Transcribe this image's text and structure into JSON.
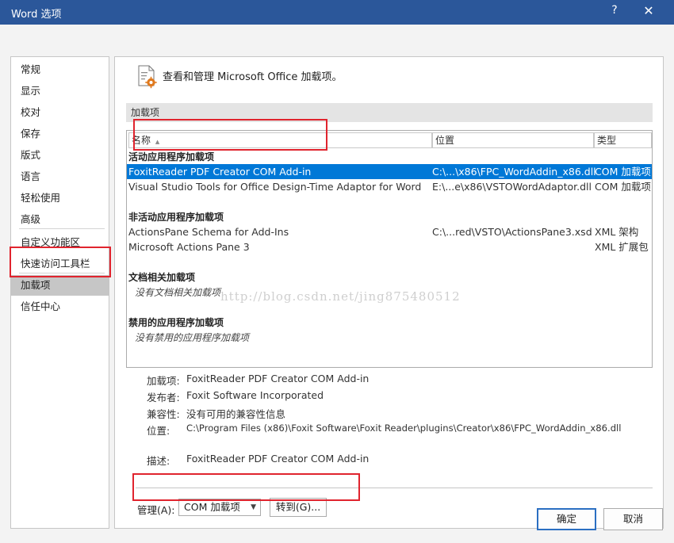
{
  "window": {
    "title": "Word 选项",
    "help": "?",
    "close": "✕"
  },
  "nav": {
    "items": [
      "常规",
      "显示",
      "校对",
      "保存",
      "版式",
      "语言",
      "轻松使用",
      "高级",
      "自定义功能区",
      "快速访问工具栏",
      "加载项",
      "信任中心"
    ],
    "selected": "加载项"
  },
  "header": {
    "icon": "addins-gear-icon",
    "text": "查看和管理 Microsoft Office 加载项。"
  },
  "section_title": "加载项",
  "list": {
    "columns": [
      "名称",
      "位置",
      "类型"
    ],
    "sort_indicator": "▲",
    "groups": [
      {
        "title": "活动应用程序加载项",
        "rows": [
          {
            "name": "FoxitReader PDF Creator COM Add-in",
            "location": "C:\\...\\x86\\FPC_WordAddin_x86.dll",
            "type": "COM 加载项",
            "selected": true
          },
          {
            "name": "Visual Studio Tools for Office Design-Time Adaptor for Word",
            "location": "E:\\...e\\x86\\VSTOWordAdaptor.dll",
            "type": "COM 加载项",
            "selected": false
          }
        ]
      },
      {
        "title": "非活动应用程序加载项",
        "rows": [
          {
            "name": "ActionsPane Schema for Add-Ins",
            "location": "C:\\...red\\VSTO\\ActionsPane3.xsd",
            "type": "XML 架构",
            "selected": false
          },
          {
            "name": "Microsoft Actions Pane 3",
            "location": "",
            "type": "XML 扩展包",
            "selected": false
          }
        ]
      },
      {
        "title": "文档相关加载项",
        "empty_text": "没有文档相关加载项"
      },
      {
        "title": "禁用的应用程序加载项",
        "empty_text": "没有禁用的应用程序加载项"
      }
    ],
    "watermark": "http://blog.csdn.net/jing875480512"
  },
  "details": {
    "addin_label": "加载项:",
    "addin_value": "FoxitReader PDF Creator COM Add-in",
    "publisher_label": "发布者:",
    "publisher_value": "Foxit Software Incorporated",
    "compat_label": "兼容性:",
    "compat_value": "没有可用的兼容性信息",
    "location_label": "位置:",
    "location_value": "C:\\Program Files (x86)\\Foxit Software\\Foxit Reader\\plugins\\Creator\\x86\\FPC_WordAddin_x86.dll",
    "desc_label": "描述:",
    "desc_value": "FoxitReader PDF Creator COM Add-in"
  },
  "manage": {
    "label": "管理(A):",
    "selected_option": "COM 加载项",
    "go_button": "转到(G)..."
  },
  "buttons": {
    "ok": "确定",
    "cancel": "取消"
  },
  "colors": {
    "titlebar": "#2b579a",
    "selection": "#0078d7",
    "highlight_box": "#e0242e"
  }
}
